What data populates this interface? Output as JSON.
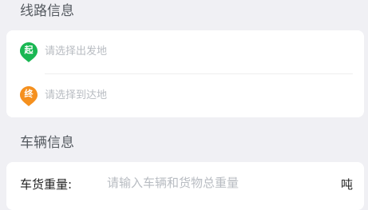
{
  "route_section": {
    "title": "线路信息",
    "start": {
      "marker": "起",
      "marker_color": "#1ab753",
      "placeholder": "请选择出发地"
    },
    "end": {
      "marker": "终",
      "marker_color": "#f5901e",
      "placeholder": "请选择到达地"
    }
  },
  "vehicle_section": {
    "title": "车辆信息",
    "weight": {
      "label": "车货重量:",
      "placeholder": "请输入车辆和货物总重量",
      "value": "",
      "unit": "吨"
    }
  },
  "colors": {
    "background": "#f0f0f4",
    "card": "#ffffff",
    "placeholder_text": "#b8bcc2"
  }
}
